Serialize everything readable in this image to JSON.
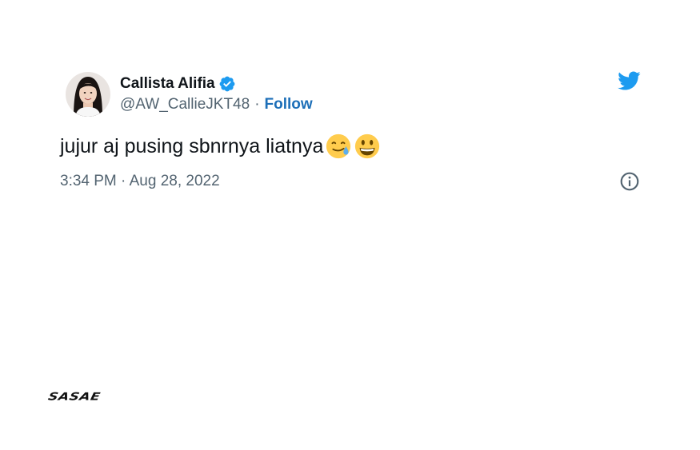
{
  "tweet": {
    "author": {
      "name": "Callista Alifia",
      "handle": "@AW_CallieJKT48",
      "verified": true,
      "avatar": "avatar-photo"
    },
    "separator": "·",
    "follow_label": "Follow",
    "text": "jujur aj pusing sbnrnya liatnya",
    "emojis": [
      "smiling-face-with-tear",
      "grinning-face-with-big-eyes"
    ],
    "time": "3:34 PM",
    "date": "Aug 28, 2022",
    "icons": {
      "brand": "twitter-bird-icon",
      "info": "info-icon",
      "verified": "verified-badge-icon"
    }
  },
  "watermark": "SASAE",
  "colors": {
    "text": "#0f1419",
    "secondary": "#536471",
    "link": "#1d6fb8",
    "twitter_blue": "#1d9bf0",
    "emoji_yellow": "#ffcc4d"
  }
}
